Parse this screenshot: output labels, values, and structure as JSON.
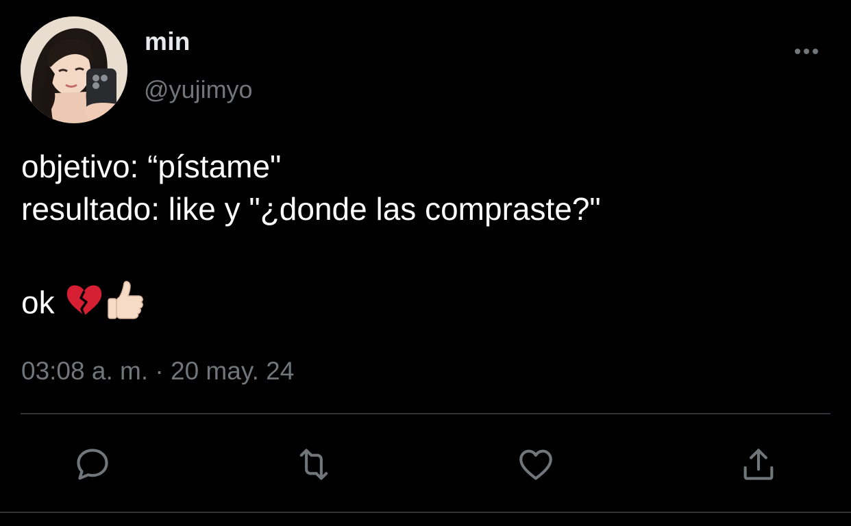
{
  "user": {
    "display_name": "min",
    "handle": "@yujimyo"
  },
  "tweet": {
    "line1": "objetivo: “pístame\"",
    "line2": "resultado: like y \"¿donde las compraste?\"",
    "line3_text": "ok",
    "emojis": [
      "broken-heart-icon",
      "thumbs-up-icon"
    ]
  },
  "meta": {
    "timestamp": "03:08 a. m. · 20 may. 24"
  },
  "actions": [
    "reply-icon",
    "retweet-icon",
    "like-icon",
    "share-icon"
  ],
  "colors": {
    "background": "#000000",
    "primary_text": "#ffffff",
    "secondary_text": "#71767b",
    "divider": "#2f3336",
    "broken_heart": "#d71f33"
  }
}
